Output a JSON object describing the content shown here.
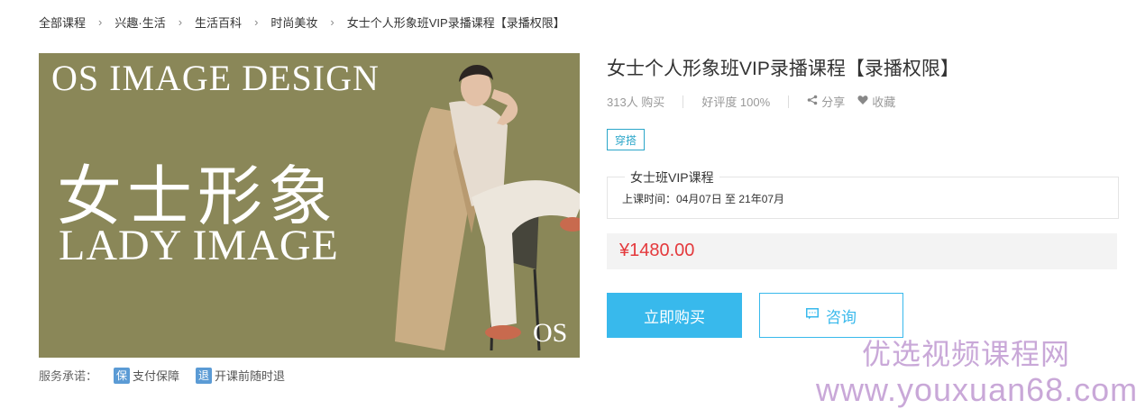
{
  "breadcrumb": [
    "全部课程",
    "兴趣·生活",
    "生活百科",
    "时尚美妆",
    "女士个人形象班VIP录播课程【录播权限】"
  ],
  "breadcrumb_separator": "›",
  "hero": {
    "line1": "OS IMAGE DESIGN",
    "line2": "女士形象",
    "line3": "LADY IMAGE",
    "mark": "OS"
  },
  "service": {
    "label": "服务承诺：",
    "items": [
      {
        "icon_char": "保",
        "icon": "shield-icon",
        "text": "支付保障"
      },
      {
        "icon_char": "退",
        "icon": "refund-icon",
        "text": "开课前随时退"
      }
    ]
  },
  "product": {
    "title": "女士个人形象班VIP录播课程【录播权限】",
    "buyers": "313人 购买",
    "rating": "好评度 100%",
    "share": "分享",
    "favorite": "收藏",
    "tag": "穿搭",
    "course_name": "女士班VIP课程",
    "course_time": "上课时间：04月07日 至 21年07月",
    "price": "¥1480.00",
    "buy_label": "立即购买",
    "ask_label": "咨询"
  },
  "watermark": {
    "line1": "优选视频课程网",
    "line2": "www.youxuan68.com"
  },
  "colors": {
    "accent": "#38b9ec",
    "price": "#e4393c",
    "tag": "#2ba6c9",
    "hero_bg": "#8a8758",
    "watermark": "#c9a8d8"
  }
}
